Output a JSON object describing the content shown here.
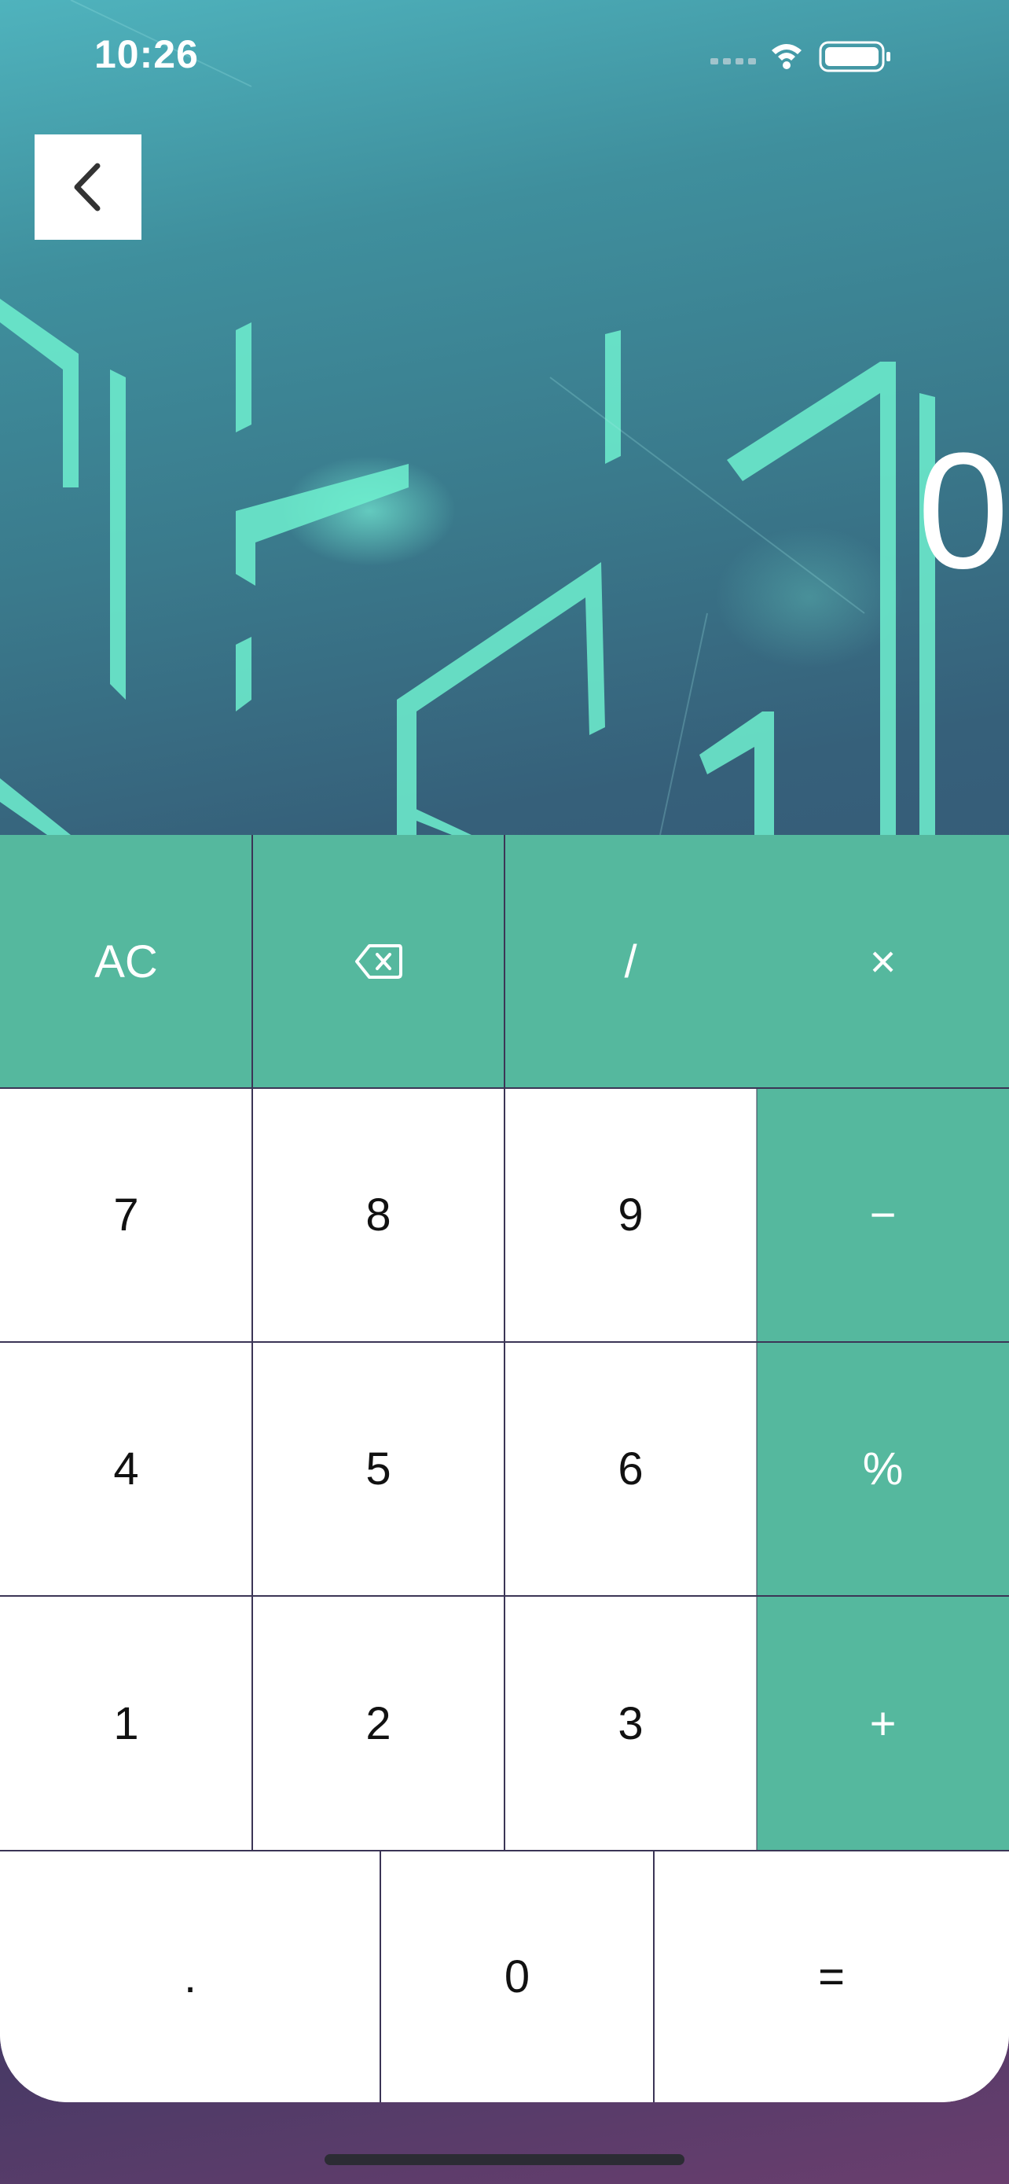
{
  "status_bar": {
    "time": "10:26",
    "icons": [
      "signal-icon",
      "wifi-icon",
      "battery-icon"
    ]
  },
  "header": {
    "back_icon": "chevron-left-icon"
  },
  "display": {
    "value": "0"
  },
  "keypad": {
    "row1": {
      "clear": "AC",
      "backspace_icon": "backspace-icon",
      "divide": "/",
      "multiply": "×"
    },
    "row2": {
      "k7": "7",
      "k8": "8",
      "k9": "9",
      "minus": "−"
    },
    "row3": {
      "k4": "4",
      "k5": "5",
      "k6": "6",
      "percent": "%"
    },
    "row4": {
      "k1": "1",
      "k2": "2",
      "k3": "3",
      "plus": "+"
    },
    "row5": {
      "dot": ".",
      "k0": "0",
      "equals": "="
    }
  },
  "colors": {
    "operator_key": "#55b89e",
    "number_key": "#ffffff",
    "grid_line": "#3b3556",
    "accent_line": "#6ff0cf"
  }
}
